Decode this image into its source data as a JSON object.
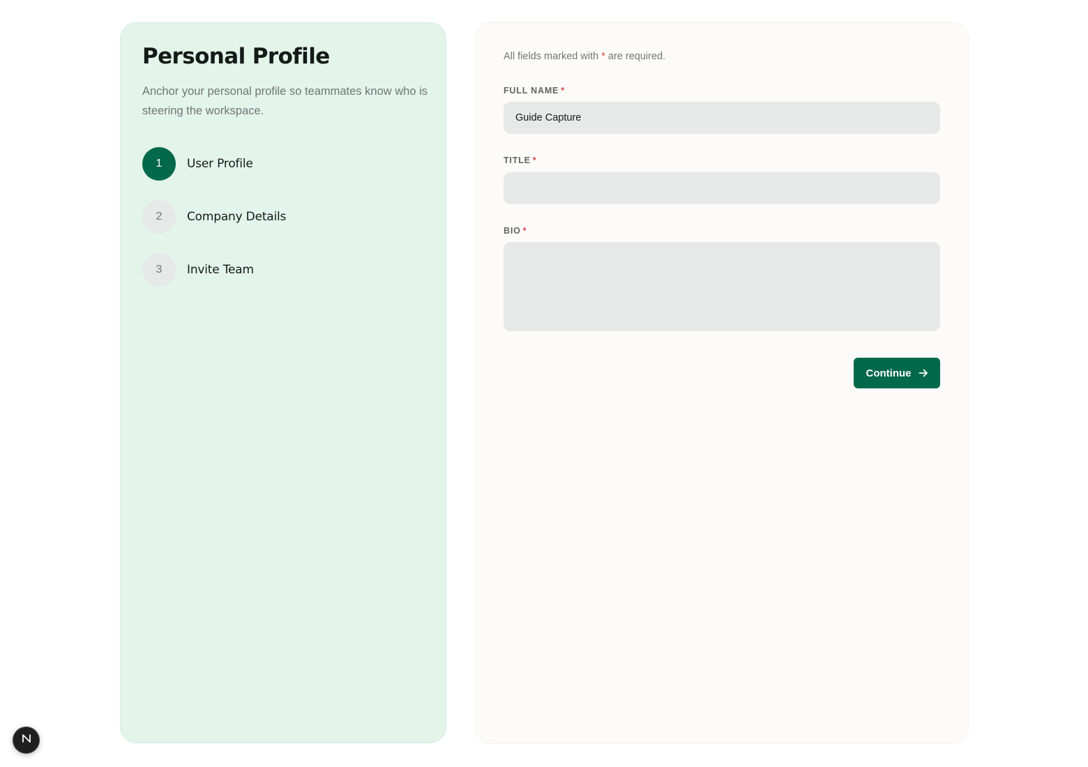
{
  "left_panel": {
    "title": "Personal Profile",
    "description": "Anchor your personal profile so teammates know who is steering the workspace.",
    "steps": [
      {
        "number": "1",
        "label": "User Profile",
        "state": "active"
      },
      {
        "number": "2",
        "label": "Company Details",
        "state": "inactive"
      },
      {
        "number": "3",
        "label": "Invite Team",
        "state": "inactive"
      }
    ]
  },
  "form": {
    "required_note_prefix": "All fields marked with ",
    "required_star": "*",
    "required_note_suffix": " are required.",
    "fields": {
      "full_name": {
        "label": "FULL NAME",
        "value": "Guide Capture",
        "placeholder": ""
      },
      "title": {
        "label": "TITLE",
        "value": "",
        "placeholder": ""
      },
      "bio": {
        "label": "BIO",
        "value": "",
        "placeholder": ""
      }
    },
    "continue_label": "Continue",
    "continue_icon": "arrow-right-icon"
  },
  "badge": {
    "icon": "n-logo-icon"
  },
  "colors": {
    "accent": "#04694b",
    "left_panel_bg": "#e3f4eb",
    "right_panel_bg": "#fcfbfa",
    "input_bg": "#e7e9e8",
    "required_star": "#d64545"
  }
}
